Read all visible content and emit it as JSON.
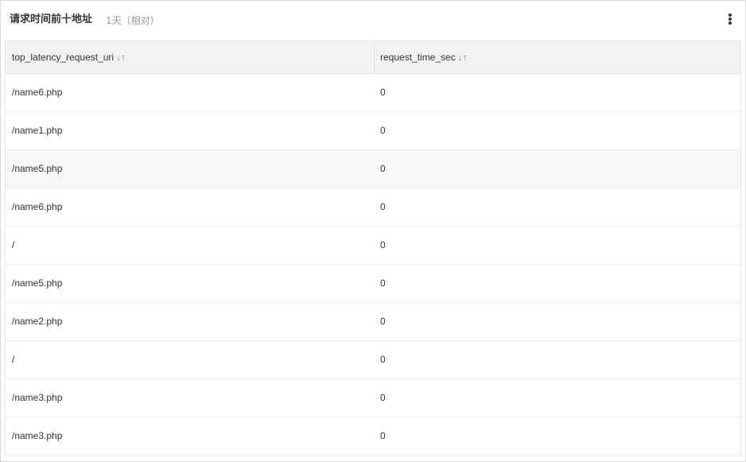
{
  "panel": {
    "title": "请求时间前十地址",
    "range": "1天（相对）",
    "more_icon": "more-vertical-icon"
  },
  "table": {
    "columns": [
      {
        "label": "top_latency_request_uri",
        "sort_icon": "↓↑"
      },
      {
        "label": "request_time_sec",
        "sort_icon": "↓↑"
      }
    ],
    "rows": [
      {
        "uri": "/name6.php",
        "time": "0"
      },
      {
        "uri": "/name1.php",
        "time": "0"
      },
      {
        "uri": "/name5.php",
        "time": "0"
      },
      {
        "uri": "/name6.php",
        "time": "0"
      },
      {
        "uri": "/",
        "time": "0"
      },
      {
        "uri": "/name5.php",
        "time": "0"
      },
      {
        "uri": "/name2.php",
        "time": "0"
      },
      {
        "uri": "/",
        "time": "0"
      },
      {
        "uri": "/name3.php",
        "time": "0"
      },
      {
        "uri": "/name3.php",
        "time": "0"
      }
    ],
    "highlighted_row_index": 2
  },
  "colors": {
    "header_bg": "#f2f2f2",
    "row_hover_bg": "#f6f7f8",
    "border": "#e6e6e6",
    "text": "#333333",
    "muted_text": "#999999"
  }
}
